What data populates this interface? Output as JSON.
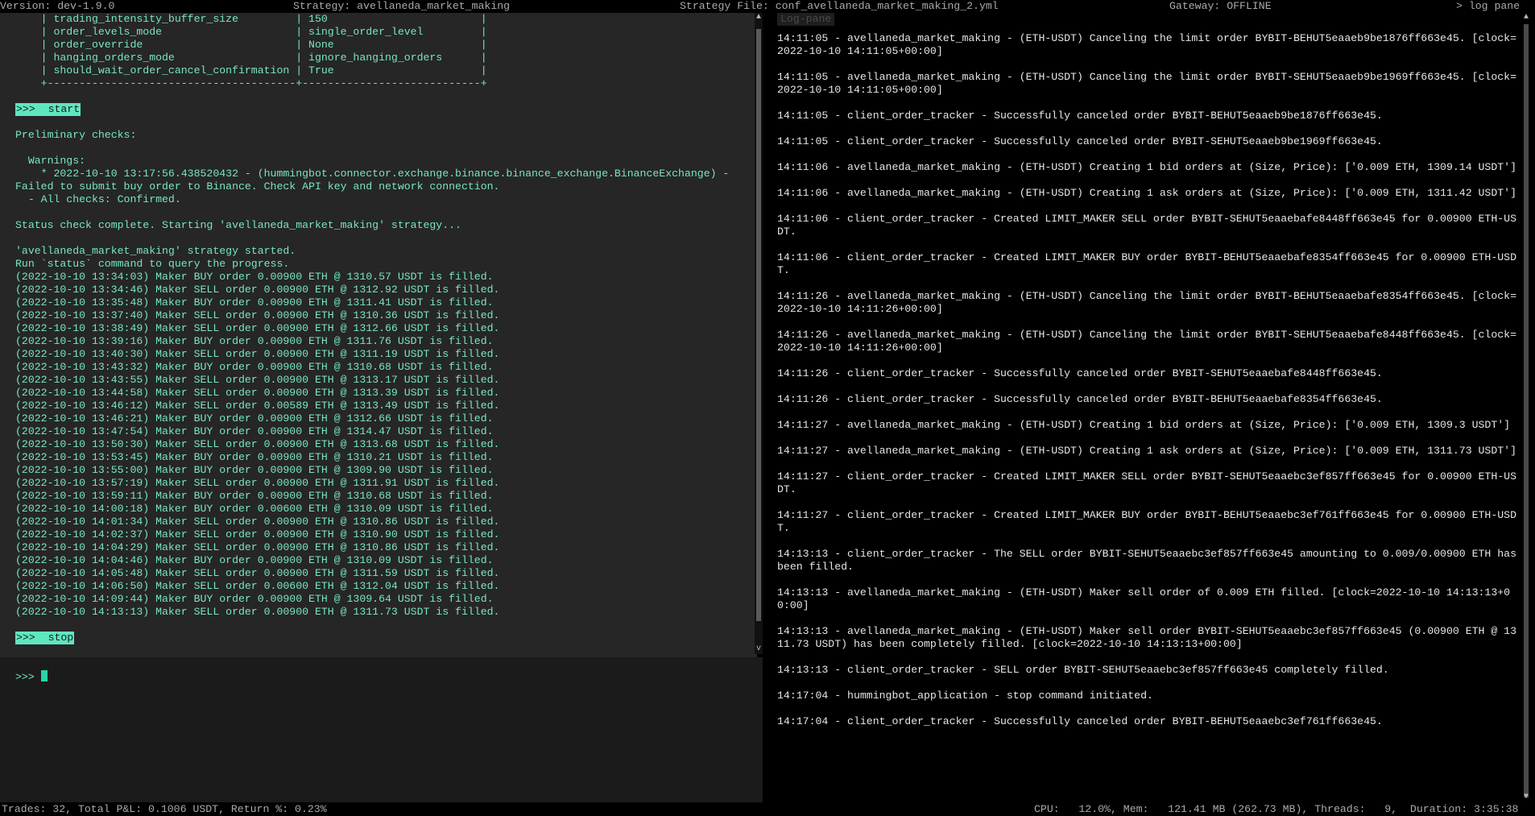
{
  "topbar": {
    "version": "Version: dev-1.9.0",
    "strategy": "Strategy: avellaneda_market_making",
    "strategy_file": "Strategy File: conf_avellaneda_market_making_2.yml",
    "gateway": "Gateway: OFFLINE",
    "log_pane": "> log pane"
  },
  "left": {
    "config_rows": [
      "    | trading_intensity_buffer_size         | 150                        |",
      "    | order_levels_mode                     | single_order_level         |",
      "    | order_override                        | None                       |",
      "    | hanging_orders_mode                   | ignore_hanging_orders      |",
      "    | should_wait_order_cancel_confirmation | True                       |",
      "    +---------------------------------------+----------------------------+"
    ],
    "start_cmd": ">>>  start",
    "prelim": "Preliminary checks:",
    "warnings_header": "  Warnings:",
    "warning_line1": "    * 2022-10-10 13:17:56.438520432 - (hummingbot.connector.exchange.binance.binance_exchange.BinanceExchange) -",
    "warning_line2": "Failed to submit buy order to Binance. Check API key and network connection.",
    "all_checks": "  - All checks: Confirmed.",
    "status_complete": "Status check complete. Starting 'avellaneda_market_making' strategy...",
    "strategy_started": "'avellaneda_market_making' strategy started.",
    "run_status": "Run `status` command to query the progress.",
    "fills": [
      "(2022-10-10 13:34:03) Maker BUY order 0.00900 ETH @ 1310.57 USDT is filled.",
      "(2022-10-10 13:34:46) Maker SELL order 0.00900 ETH @ 1312.92 USDT is filled.",
      "(2022-10-10 13:35:48) Maker BUY order 0.00900 ETH @ 1311.41 USDT is filled.",
      "(2022-10-10 13:37:40) Maker SELL order 0.00900 ETH @ 1310.36 USDT is filled.",
      "(2022-10-10 13:38:49) Maker SELL order 0.00900 ETH @ 1312.66 USDT is filled.",
      "(2022-10-10 13:39:16) Maker BUY order 0.00900 ETH @ 1311.76 USDT is filled.",
      "(2022-10-10 13:40:30) Maker SELL order 0.00900 ETH @ 1311.19 USDT is filled.",
      "(2022-10-10 13:43:32) Maker BUY order 0.00900 ETH @ 1310.68 USDT is filled.",
      "(2022-10-10 13:43:55) Maker SELL order 0.00900 ETH @ 1313.17 USDT is filled.",
      "(2022-10-10 13:44:58) Maker SELL order 0.00900 ETH @ 1313.39 USDT is filled.",
      "(2022-10-10 13:46:12) Maker SELL order 0.00589 ETH @ 1313.49 USDT is filled.",
      "(2022-10-10 13:46:21) Maker BUY order 0.00900 ETH @ 1312.66 USDT is filled.",
      "(2022-10-10 13:47:54) Maker BUY order 0.00900 ETH @ 1314.47 USDT is filled.",
      "(2022-10-10 13:50:30) Maker SELL order 0.00900 ETH @ 1313.68 USDT is filled.",
      "(2022-10-10 13:53:45) Maker BUY order 0.00900 ETH @ 1310.21 USDT is filled.",
      "(2022-10-10 13:55:00) Maker BUY order 0.00900 ETH @ 1309.90 USDT is filled.",
      "(2022-10-10 13:57:19) Maker SELL order 0.00900 ETH @ 1311.91 USDT is filled.",
      "(2022-10-10 13:59:11) Maker BUY order 0.00900 ETH @ 1310.68 USDT is filled.",
      "(2022-10-10 14:00:18) Maker BUY order 0.00600 ETH @ 1310.09 USDT is filled.",
      "(2022-10-10 14:01:34) Maker SELL order 0.00900 ETH @ 1310.86 USDT is filled.",
      "(2022-10-10 14:02:37) Maker SELL order 0.00900 ETH @ 1310.90 USDT is filled.",
      "(2022-10-10 14:04:29) Maker SELL order 0.00900 ETH @ 1310.86 USDT is filled.",
      "(2022-10-10 14:04:46) Maker BUY order 0.00900 ETH @ 1310.09 USDT is filled.",
      "(2022-10-10 14:05:48) Maker SELL order 0.00900 ETH @ 1311.59 USDT is filled.",
      "(2022-10-10 14:06:50) Maker SELL order 0.00600 ETH @ 1312.04 USDT is filled.",
      "(2022-10-10 14:09:44) Maker BUY order 0.00900 ETH @ 1309.64 USDT is filled.",
      "(2022-10-10 14:13:13) Maker SELL order 0.00900 ETH @ 1311.73 USDT is filled."
    ],
    "stop_cmd": ">>>  stop",
    "prompt": ">>>"
  },
  "right": {
    "tab_label": "Log-pane",
    "entries": [
      "14:11:05 - avellaneda_market_making - (ETH-USDT) Canceling the limit order BYBIT-BEHUT5eaaeb9be1876ff663e45. [clock=2022-10-10 14:11:05+00:00]",
      "14:11:05 - avellaneda_market_making - (ETH-USDT) Canceling the limit order BYBIT-SEHUT5eaaeb9be1969ff663e45. [clock=2022-10-10 14:11:05+00:00]",
      "14:11:05 - client_order_tracker - Successfully canceled order BYBIT-BEHUT5eaaeb9be1876ff663e45.",
      "14:11:05 - client_order_tracker - Successfully canceled order BYBIT-SEHUT5eaaeb9be1969ff663e45.",
      "14:11:06 - avellaneda_market_making - (ETH-USDT) Creating 1 bid orders at (Size, Price): ['0.009 ETH, 1309.14 USDT']",
      "14:11:06 - avellaneda_market_making - (ETH-USDT) Creating 1 ask orders at (Size, Price): ['0.009 ETH, 1311.42 USDT']",
      "14:11:06 - client_order_tracker - Created LIMIT_MAKER SELL order BYBIT-SEHUT5eaaebafe8448ff663e45 for 0.00900 ETH-USDT.",
      "14:11:06 - client_order_tracker - Created LIMIT_MAKER BUY order BYBIT-BEHUT5eaaebafe8354ff663e45 for 0.00900 ETH-USDT.",
      "14:11:26 - avellaneda_market_making - (ETH-USDT) Canceling the limit order BYBIT-BEHUT5eaaebafe8354ff663e45. [clock=2022-10-10 14:11:26+00:00]",
      "14:11:26 - avellaneda_market_making - (ETH-USDT) Canceling the limit order BYBIT-SEHUT5eaaebafe8448ff663e45. [clock=2022-10-10 14:11:26+00:00]",
      "14:11:26 - client_order_tracker - Successfully canceled order BYBIT-SEHUT5eaaebafe8448ff663e45.",
      "14:11:26 - client_order_tracker - Successfully canceled order BYBIT-BEHUT5eaaebafe8354ff663e45.",
      "14:11:27 - avellaneda_market_making - (ETH-USDT) Creating 1 bid orders at (Size, Price): ['0.009 ETH, 1309.3 USDT']",
      "14:11:27 - avellaneda_market_making - (ETH-USDT) Creating 1 ask orders at (Size, Price): ['0.009 ETH, 1311.73 USDT']",
      "14:11:27 - client_order_tracker - Created LIMIT_MAKER SELL order BYBIT-SEHUT5eaaebc3ef857ff663e45 for 0.00900 ETH-USDT.",
      "14:11:27 - client_order_tracker - Created LIMIT_MAKER BUY order BYBIT-BEHUT5eaaebc3ef761ff663e45 for 0.00900 ETH-USDT.",
      "14:13:13 - client_order_tracker - The SELL order BYBIT-SEHUT5eaaebc3ef857ff663e45 amounting to 0.009/0.00900 ETH has been filled.",
      "14:13:13 - avellaneda_market_making - (ETH-USDT) Maker sell order of 0.009 ETH filled. [clock=2022-10-10 14:13:13+00:00]",
      "14:13:13 - avellaneda_market_making - (ETH-USDT) Maker sell order BYBIT-SEHUT5eaaebc3ef857ff663e45 (0.00900 ETH @ 1311.73 USDT) has been completely filled. [clock=2022-10-10 14:13:13+00:00]",
      "14:13:13 - client_order_tracker - SELL order BYBIT-SEHUT5eaaebc3ef857ff663e45 completely filled.",
      "14:17:04 - hummingbot_application - stop command initiated.",
      "14:17:04 - client_order_tracker - Successfully canceled order BYBIT-BEHUT5eaaebc3ef761ff663e45."
    ]
  },
  "statusbar": {
    "trades": "Trades: 32, Total P&L: 0.1006 USDT, Return %: 0.23%",
    "resources": "CPU:   12.0%, Mem:   121.41 MB (262.73 MB), Threads:   9,  Duration: 3:35:38"
  },
  "colors": {
    "output_text": "#78e6c3",
    "command_bg": "#5fe6c0",
    "log_text": "#e6e6e6",
    "pane_bg": "#262626",
    "input_bg": "#1b1b1b"
  }
}
